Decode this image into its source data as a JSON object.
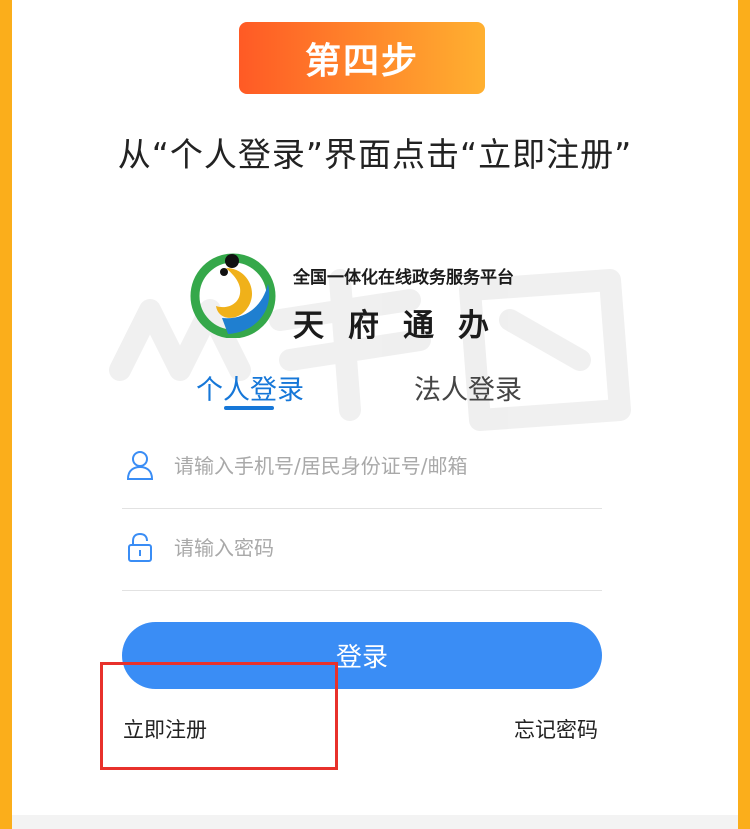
{
  "step_badge": "第四步",
  "instruction": "从“个人登录”界面点击“立即注册”",
  "platform": {
    "subtitle": "全国一体化在线政务服务平台",
    "name": "天府通办"
  },
  "tabs": [
    {
      "label": "个人登录",
      "active": true
    },
    {
      "label": "法人登录",
      "active": false
    }
  ],
  "form": {
    "user_placeholder": "请输入手机号/居民身份证号/邮箱",
    "password_placeholder": "请输入密码",
    "login_label": "登录"
  },
  "links": {
    "register": "立即注册",
    "forgot": "忘记密码"
  },
  "icons": {
    "user": "user-icon",
    "lock": "lock-icon",
    "logo": "tianfu-logo"
  },
  "colors": {
    "frame": "#fbae1b",
    "badge_start": "#ff5a25",
    "badge_end": "#ffb030",
    "accent": "#1677d8",
    "button": "#3a8df5",
    "highlight": "#e8312b"
  }
}
